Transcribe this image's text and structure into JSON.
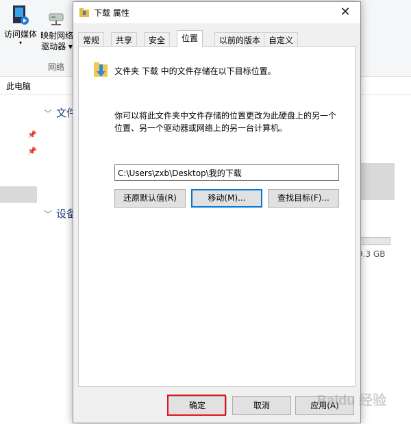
{
  "explorer": {
    "ribbon": {
      "access_media": "访问媒体",
      "map_network": "映射网络",
      "map_network_line2": "驱动器 ▾",
      "network_group": "网络"
    },
    "address": "此电脑",
    "sections": {
      "folders": "文件",
      "devices": "设备"
    },
    "disk_free_text": "9.3 GB",
    "disk_fragment": ")"
  },
  "dialog": {
    "title": "下载 属性",
    "tabs": [
      {
        "label": "常规"
      },
      {
        "label": "共享"
      },
      {
        "label": "安全"
      },
      {
        "label": "位置"
      },
      {
        "label": "以前的版本"
      },
      {
        "label": "自定义"
      }
    ],
    "active_tab": "位置",
    "intro": "文件夹 下载 中的文件存储在以下目标位置。",
    "description_line1": "你可以将此文件夹中文件存储的位置更改为此硬盘上的另一个",
    "description_line2": "位置、另一个驱动器或网络上的另一台计算机。",
    "path_value": "C:\\Users\\zxb\\Desktop\\我的下载",
    "buttons": {
      "restore_default": "还原默认值(R)",
      "move": "移动(M)...",
      "find_target": "查找目标(F)..."
    },
    "footer": {
      "ok": "确定",
      "cancel": "取消",
      "apply": "应用(A)"
    }
  },
  "watermark": "Baidu 经验",
  "colors": {
    "accent_blue": "#0078d7",
    "highlight_red": "#e0141e",
    "dialog_bg": "#f0f0f0"
  }
}
